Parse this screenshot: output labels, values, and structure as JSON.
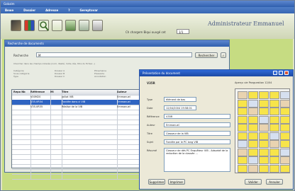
{
  "app": {
    "title": "Gobalm",
    "menus": [
      "Bewe",
      "Dossier",
      "Adresse",
      "?",
      "Gereptovar"
    ],
    "user": "Administrateur   Emmanuel",
    "toolbar_hint": "Ch chargem Biqui ouvgé cet",
    "toolbar_field": "1/1"
  },
  "search_window": {
    "title": "Recherche de documents",
    "search_label": "Recherche",
    "search_value": "M",
    "search_button": "Rechercher",
    "options_text": "Chercher dans les champs indexés (nom, libellé, mots-clés, titre du fichier...)",
    "criteria_col1": [
      "Catégorie",
      "Sous-catégorie",
      "Type"
    ],
    "criteria_col2": [
      "Dossier A",
      "Dossier B",
      "Dossier C"
    ],
    "criteria_col3": [
      "Ptrsemaine",
      "Pressacle",
      "Annotation"
    ]
  },
  "table": {
    "headers": [
      "Repo Nb",
      "Référence",
      "Mi",
      "Titre",
      "Auteur"
    ],
    "rows": [
      [
        "",
        "V00M20",
        "",
        "Jaillat VIB",
        "Emmanuel"
      ],
      [
        "",
        "V35-VR34",
        "",
        "Fondée dans ci VIB",
        "Emmanuel"
      ],
      [
        "",
        "V35-VR35",
        "",
        "Réalise de la VIB",
        "Emmanuel"
      ]
    ],
    "selected_index": 1,
    "empty_rows": 14
  },
  "detail_dialog": {
    "title": "Présentation du document",
    "doc_code": "V35R",
    "preview_label": "Aperçu vie Panguestion 12/04",
    "fields": [
      {
        "label": "Type",
        "value": "élément de bas"
      },
      {
        "label": "Date",
        "value": "12/04/2004  19:58:01"
      },
      {
        "label": "Référence",
        "value": "V35R"
      },
      {
        "label": "Auteur",
        "value": "Emmanuel"
      },
      {
        "label": "Titre",
        "value": "Classeur de la VIB"
      },
      {
        "label": "Sujet",
        "value": "Fondée par le PC long VIB"
      },
      {
        "label": "Résumé",
        "value": "Classeur de dés PC Enquêteur VIB - Adsorbé de la reduction de la classée ..."
      }
    ],
    "buttons": {
      "left1": "Supprimer",
      "left2": "Imprimer",
      "right1": "Valider",
      "right2": "Annuler"
    }
  },
  "colors": {
    "title_bar": "#2f5fae",
    "workspace": "#c6dc82",
    "selection": "#2f64c2",
    "thumbnail": "#f7e44a"
  },
  "icons": [
    "folder-stack-icon",
    "books-icon",
    "search-icon",
    "document-icon",
    "network-icon",
    "tools-icon",
    "printer-icon"
  ]
}
